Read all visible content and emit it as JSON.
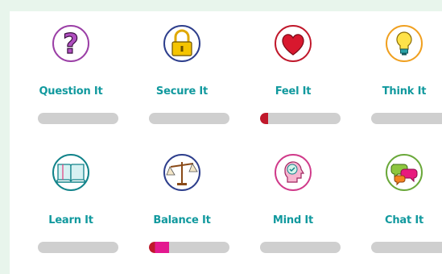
{
  "tiles": [
    {
      "label": "Question It",
      "icon": "question-mark-icon",
      "progress": 0,
      "fill_colors": []
    },
    {
      "label": "Secure It",
      "icon": "padlock-icon",
      "progress": 0,
      "fill_colors": []
    },
    {
      "label": "Feel It",
      "icon": "heart-icon",
      "progress": 0.1,
      "fill_colors": [
        "#c0182b"
      ]
    },
    {
      "label": "Think It",
      "icon": "lightbulb-icon",
      "progress": 0,
      "fill_colors": []
    },
    {
      "label": "Learn It",
      "icon": "book-icon",
      "progress": 0,
      "fill_colors": []
    },
    {
      "label": "Balance It",
      "icon": "scales-icon",
      "progress": 0.25,
      "fill_colors": [
        "#c0182b",
        "#e3188f"
      ]
    },
    {
      "label": "Mind It",
      "icon": "mind-head-icon",
      "progress": 0,
      "fill_colors": []
    },
    {
      "label": "Chat It",
      "icon": "chat-bubbles-icon",
      "progress": 0,
      "fill_colors": []
    }
  ],
  "colors": {
    "label": "#11999e",
    "track": "#cfcfcf",
    "page_background": "#e8f5ec"
  }
}
